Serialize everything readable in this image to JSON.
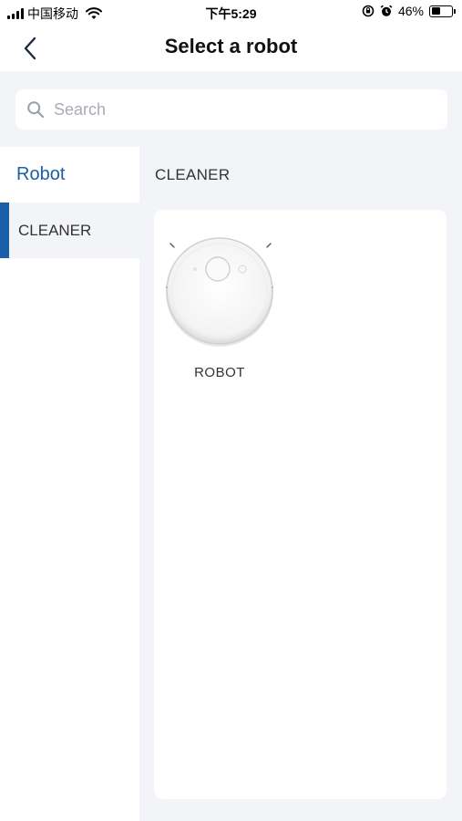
{
  "status_bar": {
    "carrier": "中国移动",
    "time": "下午5:29",
    "battery_percent_text": "46%",
    "battery_level": 0.46,
    "icons": [
      "signal-icon",
      "wifi-icon",
      "rotation-lock-icon",
      "alarm-icon",
      "battery-icon"
    ]
  },
  "nav": {
    "title": "Select a robot",
    "back_icon": "chevron-left-icon"
  },
  "search": {
    "placeholder": "Search",
    "value": "",
    "icon": "search-icon"
  },
  "sidebar": {
    "header": "Robot",
    "items": [
      {
        "label": "CLEANER",
        "selected": true
      }
    ]
  },
  "main": {
    "section_title": "CLEANER",
    "devices": [
      {
        "label": "ROBOT",
        "icon": "robot-vacuum-icon"
      }
    ]
  },
  "colors": {
    "accent": "#1a5fa8",
    "background": "#f2f4f8",
    "surface": "#ffffff"
  }
}
